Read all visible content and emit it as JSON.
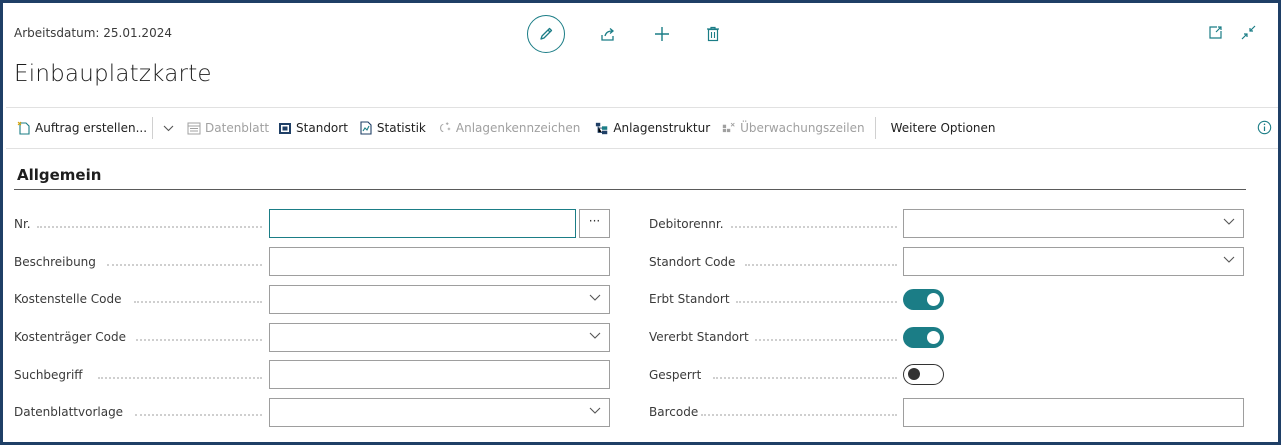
{
  "header": {
    "workdate": "Arbeitsdatum: 25.01.2024",
    "title": "Einbauplatzkarte"
  },
  "actions": {
    "auftrag": "Auftrag erstellen...",
    "datenblatt": "Datenblatt",
    "standort": "Standort",
    "statistik": "Statistik",
    "anlagenkennzeichen": "Anlagenkennzeichen",
    "anlagenstruktur": "Anlagenstruktur",
    "ueberwachung": "Überwachungszeilen",
    "weitere": "Weitere Optionen"
  },
  "section": {
    "title": "Allgemein"
  },
  "left_fields": {
    "nr": {
      "label": "Nr.",
      "value": "",
      "lookup": "···"
    },
    "beschreibung": {
      "label": "Beschreibung",
      "value": ""
    },
    "kostenstelle": {
      "label": "Kostenstelle Code",
      "value": ""
    },
    "kostentraeger": {
      "label": "Kostenträger Code",
      "value": ""
    },
    "suchbegriff": {
      "label": "Suchbegriff",
      "value": ""
    },
    "datenblattvorlage": {
      "label": "Datenblattvorlage",
      "value": ""
    }
  },
  "right_fields": {
    "debitorennr": {
      "label": "Debitorennr.",
      "value": ""
    },
    "standort_code": {
      "label": "Standort Code",
      "value": ""
    },
    "erbt_standort": {
      "label": "Erbt Standort",
      "checked": true
    },
    "vererbt_standort": {
      "label": "Vererbt Standort",
      "checked": true
    },
    "gesperrt": {
      "label": "Gesperrt",
      "checked": false
    },
    "barcode": {
      "label": "Barcode",
      "value": ""
    }
  },
  "colors": {
    "accent": "#1b7d86",
    "frame": "#1f3f66"
  },
  "icons": {
    "edit": "pencil-icon",
    "share": "share-icon",
    "new": "plus-icon",
    "delete": "trash-icon",
    "open_new_window": "open-in-new-window-icon",
    "collapse": "collapse-icon",
    "info": "info-icon"
  }
}
